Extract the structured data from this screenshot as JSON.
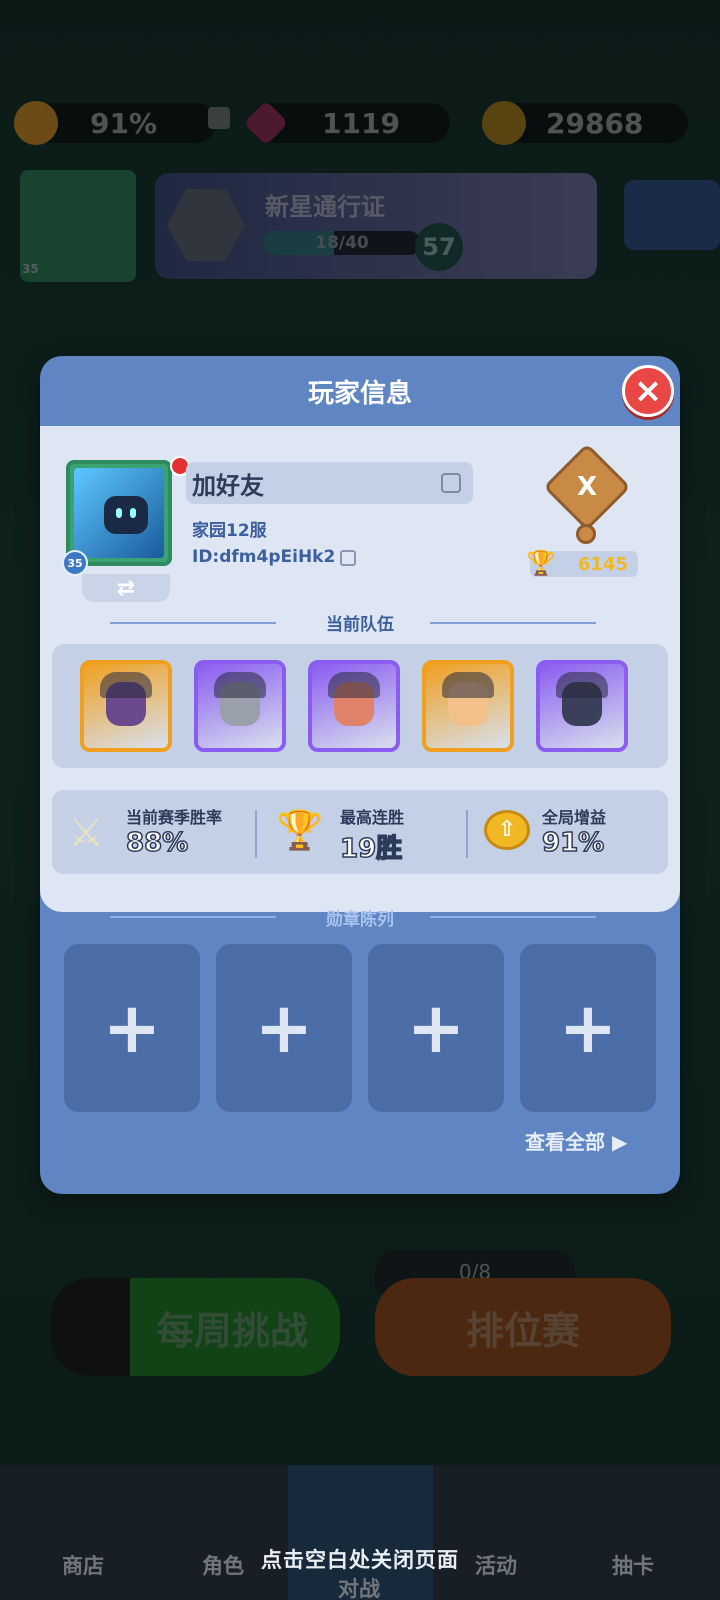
{
  "top_bar": {
    "buff_value": "91%",
    "gems_value": "1119",
    "coins_value": "29868"
  },
  "pass": {
    "title": "新星通行证",
    "progress_text": "18/40",
    "progress_fraction": 0.45,
    "level": "57"
  },
  "profile_level_bg": "35",
  "background": {
    "weekly_challenge": "每周挑战",
    "ranked": "排位赛",
    "ranked_counter": "0/8"
  },
  "bottom_nav": {
    "shop": "商店",
    "characters": "角色",
    "battle": "对战",
    "events": "活动",
    "gacha": "抽卡"
  },
  "close_hint": "点击空白处关闭页面",
  "modal": {
    "title": "玩家信息",
    "close_icon": "close-icon",
    "player": {
      "name": "加好友",
      "server": "家园12服",
      "id": "ID:dfm4pEiHk2",
      "level": "35",
      "rank_letter": "X",
      "trophies": "6145"
    },
    "team_title": "当前队伍",
    "team": [
      {
        "name": "hero-dark-elf",
        "rarity_color": "#f0a020",
        "face": "#6a4a8c"
      },
      {
        "name": "hero-knight",
        "rarity_color": "#8a5cf0",
        "face": "#9aa0aa"
      },
      {
        "name": "hero-barbarian",
        "rarity_color": "#8a5cf0",
        "face": "#e0836a"
      },
      {
        "name": "hero-blonde-gunner",
        "rarity_color": "#f0a020",
        "face": "#f2c088"
      },
      {
        "name": "hero-masked-assassin",
        "rarity_color": "#8a5cf0",
        "face": "#3a3f5a"
      }
    ],
    "stats": [
      {
        "label": "当前赛季胜率",
        "value": "88%",
        "icon": "crossed-swords-icon"
      },
      {
        "label": "最高连胜",
        "value": "19胜",
        "icon": "trophy-icon"
      },
      {
        "label": "全局增益",
        "value": "91%",
        "icon": "buff-arrow-icon"
      }
    ],
    "medal_title": "勋章陈列",
    "medal_slots": [
      "+",
      "+",
      "+",
      "+"
    ],
    "view_all": "查看全部 ▶"
  },
  "colors": {
    "modal_bg": "#5f86c2",
    "panel_bg": "#dfe6f3",
    "close_red": "#e94646",
    "trophy_gold": "#f1b824"
  }
}
